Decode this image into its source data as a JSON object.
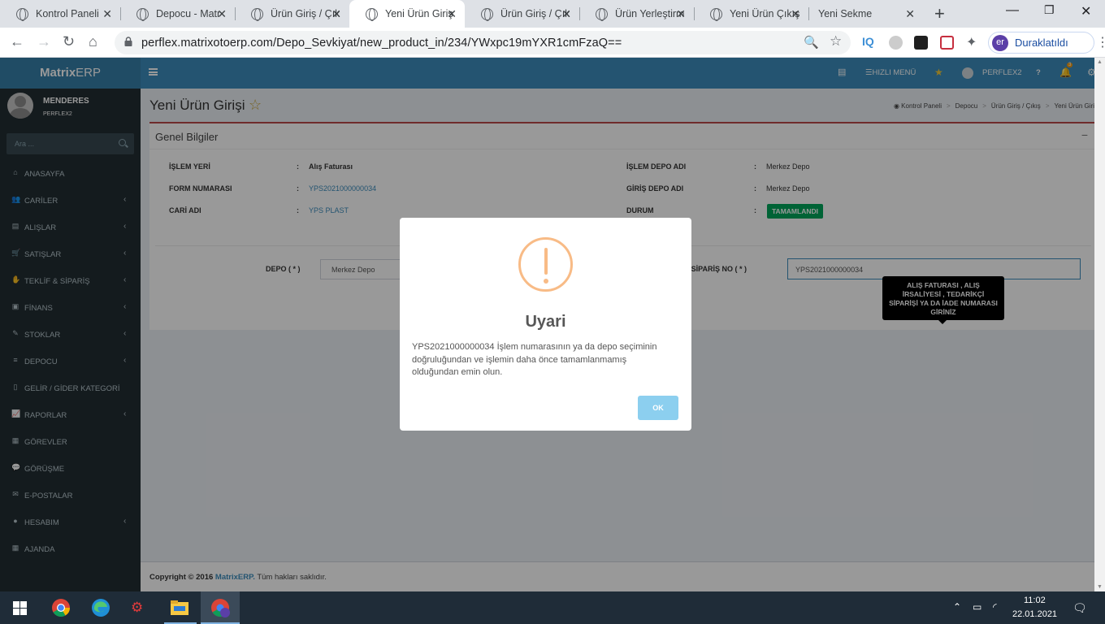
{
  "browser": {
    "tabs": [
      {
        "title": "Kontrol Paneli",
        "active": false
      },
      {
        "title": "Depocu - Matr",
        "active": false
      },
      {
        "title": "Ürün Giriş / Çık",
        "active": false
      },
      {
        "title": "Yeni Ürün Giriş",
        "active": true
      },
      {
        "title": "Ürün Giriş / Çık",
        "active": false
      },
      {
        "title": "Ürün Yerleştirm",
        "active": false
      },
      {
        "title": "Yeni Ürün Çıkış",
        "active": false
      },
      {
        "title": "Yeni Sekme",
        "active": false
      }
    ],
    "url": "perflex.matrixotoerp.com/Depo_Sevkiyat/new_product_in/234/YWxpc19mYXR1cmFzaQ==",
    "profile_initials": "er",
    "profile_label": "Duraklatıldı"
  },
  "app": {
    "logo_bold": "Matrix",
    "logo_light": "ERP",
    "user_name": "MENDERES",
    "user_company": "PERFLEX2",
    "search_placeholder": "Ara ...",
    "menu": [
      {
        "label": "ANASAYFA",
        "icon": "home-icon",
        "glyph": "⌂",
        "caret": false
      },
      {
        "label": "CARİLER",
        "icon": "users-icon",
        "glyph": "👥",
        "caret": true
      },
      {
        "label": "ALIŞLAR",
        "icon": "invoice-icon",
        "glyph": "▤",
        "caret": true
      },
      {
        "label": "SATIŞLAR",
        "icon": "cart-icon",
        "glyph": "🛒",
        "caret": true
      },
      {
        "label": "TEKLİF & SİPARİŞ",
        "icon": "handshake-icon",
        "glyph": "✋",
        "caret": true
      },
      {
        "label": "FİNANS",
        "icon": "money-icon",
        "glyph": "▣",
        "caret": true
      },
      {
        "label": "STOKLAR",
        "icon": "edit-icon",
        "glyph": "✎",
        "caret": true
      },
      {
        "label": "DEPOCU",
        "icon": "database-icon",
        "glyph": "≡",
        "caret": true
      },
      {
        "label": "GELİR / GİDER KATEGORİ",
        "icon": "file-icon",
        "glyph": "▯",
        "caret": false
      },
      {
        "label": "RAPORLAR",
        "icon": "chart-icon",
        "glyph": "📈",
        "caret": true
      },
      {
        "label": "GÖREVLER",
        "icon": "grid-icon",
        "glyph": "▦",
        "caret": false
      },
      {
        "label": "GÖRÜŞME",
        "icon": "chat-icon",
        "glyph": "💬",
        "caret": false
      },
      {
        "label": "E-POSTALAR",
        "icon": "mail-icon",
        "glyph": "✉",
        "caret": false
      },
      {
        "label": "HESABIM",
        "icon": "account-icon",
        "glyph": "●",
        "caret": true
      },
      {
        "label": "AJANDA",
        "icon": "calendar-icon",
        "glyph": "▦",
        "caret": false
      }
    ],
    "topnav": {
      "quick_menu": "HIZLI MENÜ",
      "user": "PERFLEX2",
      "help": "?",
      "notification_count": "3"
    },
    "page_title": "Yeni Ürün Girişi",
    "breadcrumb": [
      "Kontrol Paneli",
      "Depocu",
      "Ürün Giriş / Çıkış",
      "Yeni Ürün Giri"
    ],
    "box_title": "Genel Bilgiler",
    "fields_left": [
      {
        "label": "İŞLEM YERİ",
        "value": "Alış Faturası",
        "link": false,
        "bold": true
      },
      {
        "label": "FORM NUMARASI",
        "value": "YPS2021000000034",
        "link": true,
        "bold": false
      },
      {
        "label": "CARİ ADI",
        "value": "YPS PLAST",
        "link": true,
        "bold": false
      }
    ],
    "fields_right": [
      {
        "label": "İŞLEM DEPO ADI",
        "value": "Merkez Depo"
      },
      {
        "label": "GİRİŞ DEPO ADI",
        "value": "Merkez Depo"
      },
      {
        "label": "DURUM",
        "value": ""
      }
    ],
    "status_badge": "TAMAMLANDI",
    "depo_label": "DEPO ( * )",
    "depo_value": "Merkez Depo",
    "fatura_label": "URA / SİPARİŞ NO ( * )",
    "fatura_value": "YPS2021000000034",
    "tooltip": "ALIŞ FATURASI , ALIŞ İRSALİYESİ , TEDARİKÇİ SİPARİŞİ YA DA İADE NUMARASI GİRİNİZ",
    "footer_copyright": "Copyright © 2016",
    "footer_brand": "MatrixERP.",
    "footer_rest": " Tüm hakları saklıdır."
  },
  "modal": {
    "title": "Uyari",
    "text": "YPS2021000000034 İşlem numarasının ya da depo seçiminin doğruluğundan ve işlemin daha önce tamamlanmamış olduğundan emin olun.",
    "ok_label": "OK"
  },
  "taskbar": {
    "time": "11:02",
    "date": "22.01.2021"
  },
  "colors": {
    "sidebar": "#222d32",
    "topnav": "#3c8dbc",
    "success_badge": "#00a65a",
    "warning": "#f8bb86",
    "ok_button": "#8ccfef"
  }
}
